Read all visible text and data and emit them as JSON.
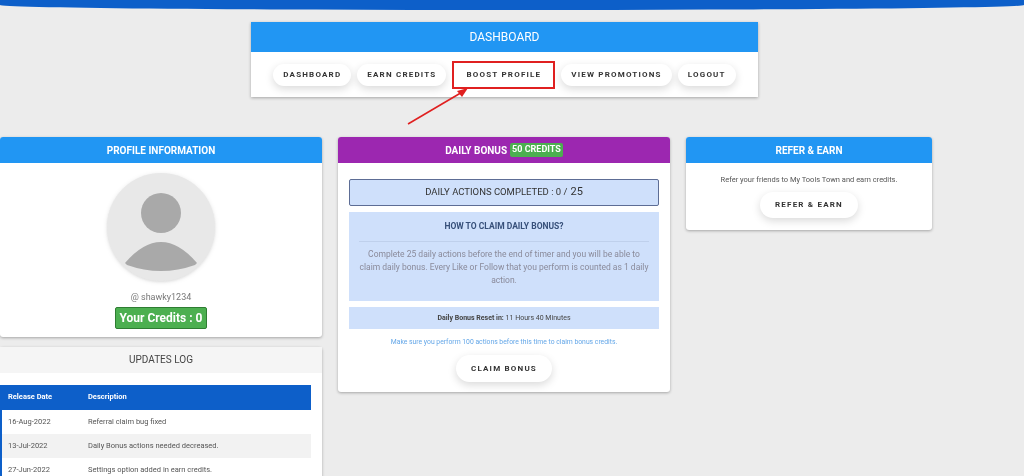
{
  "dashboard": {
    "title": "DASHBOARD",
    "nav": [
      {
        "label": "DASHBOARD",
        "highlighted": false
      },
      {
        "label": "EARN CREDITS",
        "highlighted": false
      },
      {
        "label": "BOOST PROFILE",
        "highlighted": true
      },
      {
        "label": "VIEW PROMOTIONS",
        "highlighted": false
      },
      {
        "label": "LOGOUT",
        "highlighted": false
      }
    ]
  },
  "profile": {
    "title": "PROFILE INFORMATION",
    "username": "@ shawky1234",
    "credits": "Your Credits : 0"
  },
  "updates_log": {
    "title": "UPDATES LOG",
    "columns": [
      "Release Date",
      "Description"
    ],
    "rows": [
      {
        "date": "16-Aug-2022",
        "description": "Referral claim bug fixed"
      },
      {
        "date": "13-Jul-2022",
        "description": "Daily Bonus actions needed decreased."
      },
      {
        "date": "27-Jun-2022",
        "description": "Settings option added in earn credits."
      }
    ]
  },
  "daily_bonus": {
    "title": "DAILY BONUS",
    "badge": "50 CREDITS",
    "progress_label": "DAILY ACTIONS COMPLETED : 0 /",
    "progress_total": "25",
    "how_title": "HOW TO CLAIM DAILY BONUS?",
    "how_text": "Complete 25 daily actions before the end of timer and you will be able to claim daily bonus. Every Like or Follow that you perform is counted as 1 daily action.",
    "reset": "**Daily Bonus Reset in:** 11 Hours 40 Minutes",
    "note": "Make sure you perform 100 actions before this time to claim bonus credits.",
    "button": "CLAIM BONUS"
  },
  "refer": {
    "title": "REFER & EARN",
    "text": "Refer your friends to My Tools Town and earn credits.",
    "button": "REFER & EARN"
  }
}
